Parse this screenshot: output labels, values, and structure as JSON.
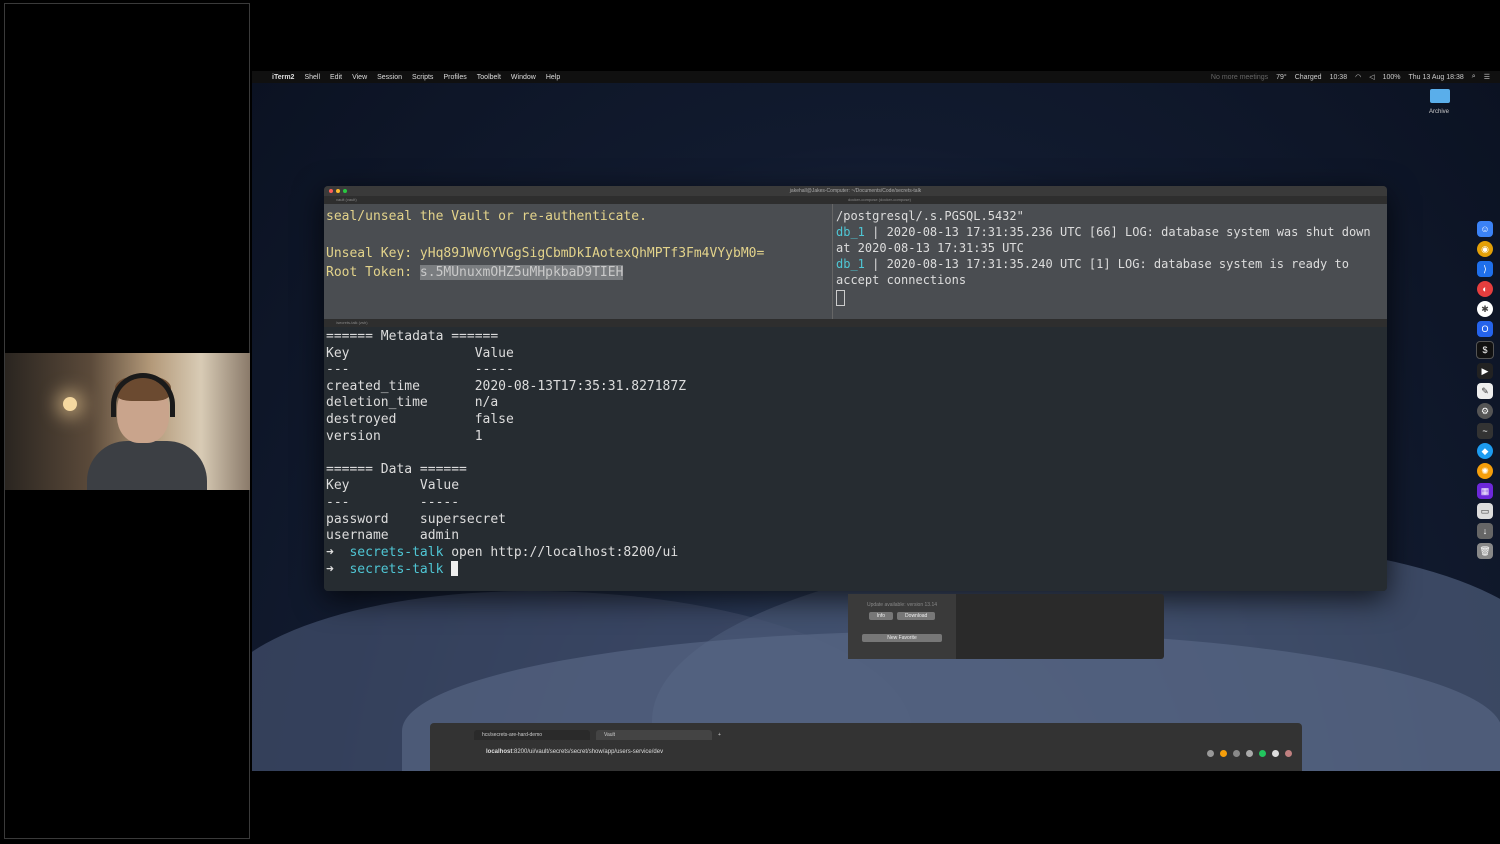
{
  "menubar": {
    "apple": "",
    "items": [
      "iTerm2",
      "Shell",
      "Edit",
      "View",
      "Session",
      "Scripts",
      "Profiles",
      "Toolbelt",
      "Window",
      "Help"
    ],
    "status_faint": "No more meetings",
    "temperature": "79°",
    "battery_label": "Charged",
    "time_short": "10:38",
    "battery_pct": "100%",
    "datetime": "Thu 13 Aug 18:38"
  },
  "desktop": {
    "archive_label": "Archive"
  },
  "terminal": {
    "window_title": "jakehall@Jakes-Computer: ~/Documents/Code/secrets-talk",
    "top_left_tab": "vault (vault)",
    "top_right_tab": "docker-compose (docker-compose)",
    "bottom_tab": "/secrets-talk (zsh)",
    "top_left": {
      "line1": "seal/unseal the Vault or re-authenticate.",
      "unseal_label": "Unseal Key:",
      "unseal_value": "yHq89JWV6YVGgSigCbmDkIAotexQhMPTf3Fm4VYybM0=",
      "root_label": "Root Token:",
      "root_value": "s.5MUnuxmOHZ5uMHpkbaD9TIEH"
    },
    "top_right": {
      "line0": "/postgresql/.s.PGSQL.5432\"",
      "db1": "db_1",
      "log1": "  | 2020-08-13 17:31:35.236 UTC [66] LOG:  database system was shut down at 2020-08-13 17:31:35 UTC",
      "db2": "db_1",
      "log2": "  | 2020-08-13 17:31:35.240 UTC [1] LOG:  database system is ready to accept connections"
    },
    "bottom": {
      "metadata_header": "====== Metadata ======",
      "meta_cols": "Key                Value",
      "meta_sep": "---                -----",
      "meta_rows": [
        "created_time       2020-08-13T17:35:31.827187Z",
        "deletion_time      n/a",
        "destroyed          false",
        "version            1"
      ],
      "data_header": "====== Data ======",
      "data_cols": "Key         Value",
      "data_sep": "---         -----",
      "data_rows": [
        "password    supersecret",
        "username    admin"
      ],
      "prompt_arrow": "➜",
      "prompt_dir": "secrets-talk",
      "cmd1": "open http://localhost:8200/ui"
    }
  },
  "popup": {
    "message": "Update available: version 13.14",
    "info_btn": "Info",
    "download_btn": "Download",
    "new_favorite_btn": "New Favorite"
  },
  "browser": {
    "tab1": "hcs/secrets-are-hard-demo",
    "tab2": "Vault",
    "url_host": "localhost",
    "url_path": ":8200/ui/vault/secrets/secret/show/app/users-service/dev"
  }
}
